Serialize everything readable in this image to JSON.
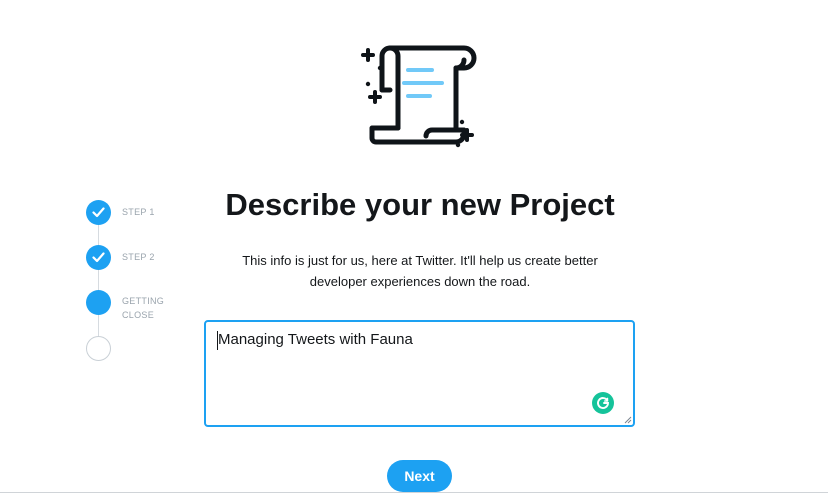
{
  "illustration": {
    "icon": "scroll-document-icon",
    "accent_color": "#71c9f8"
  },
  "stepper": {
    "steps": [
      {
        "label": "STEP 1",
        "state": "done"
      },
      {
        "label": "STEP 2",
        "state": "done"
      },
      {
        "label": "GETTING CLOSE",
        "state": "current"
      },
      {
        "label": "",
        "state": "todo"
      }
    ]
  },
  "main": {
    "title": "Describe your new Project",
    "subtitle": "This info is just for us, here at Twitter. It'll help us create better developer experiences down the road.",
    "description": {
      "value": "Managing Tweets with Fauna"
    },
    "next_label": "Next"
  },
  "colors": {
    "accent": "#1da1f2",
    "grammarly": "#15c39a",
    "text": "#14171a",
    "muted": "#9aa4ad"
  }
}
